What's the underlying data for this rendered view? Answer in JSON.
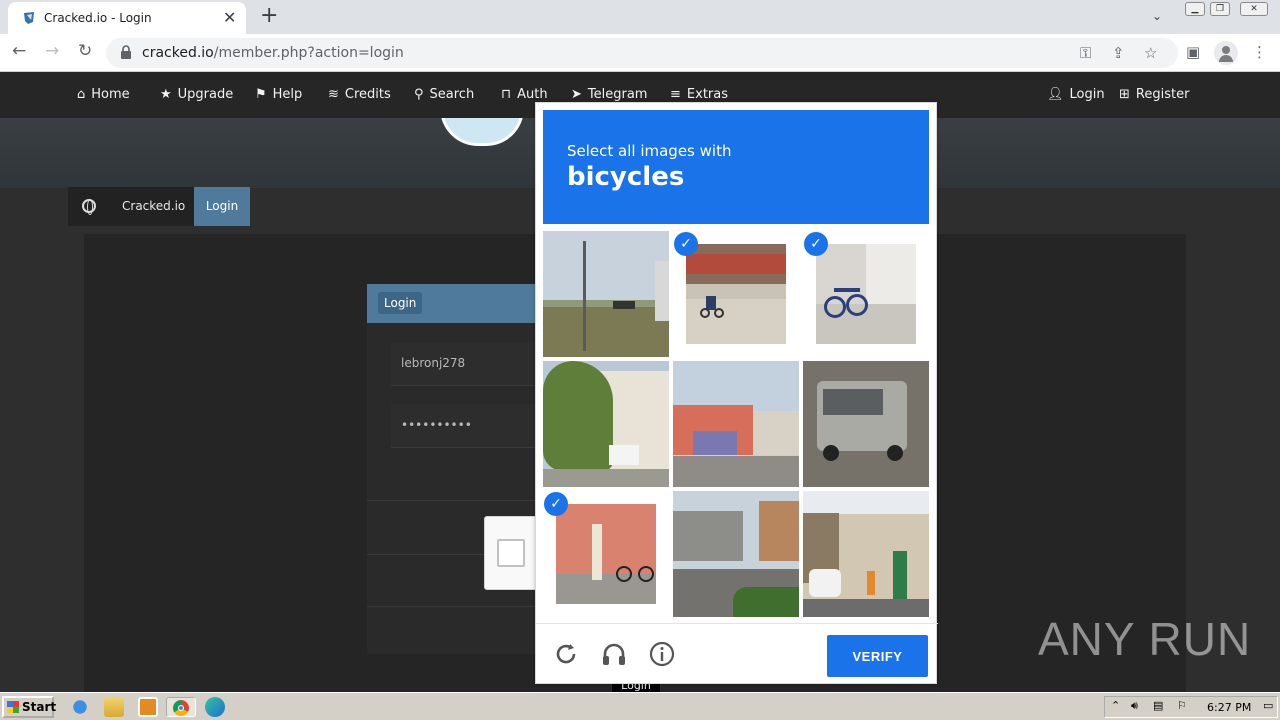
{
  "browser": {
    "tab_title": "Cracked.io - Login",
    "url_host": "cracked.io",
    "url_path": "/member.php?action=login"
  },
  "site_nav": {
    "items": [
      {
        "label": "Home",
        "icon": "home-icon"
      },
      {
        "label": "Upgrade",
        "icon": "star-icon"
      },
      {
        "label": "Help",
        "icon": "flag-icon"
      },
      {
        "label": "Credits",
        "icon": "coins-icon"
      },
      {
        "label": "Search",
        "icon": "search-icon"
      },
      {
        "label": "Auth",
        "icon": "lock-icon"
      },
      {
        "label": "Telegram",
        "icon": "telegram-icon"
      },
      {
        "label": "Extras",
        "icon": "menu-icon"
      }
    ],
    "right": [
      {
        "label": "Login",
        "icon": "user-icon"
      },
      {
        "label": "Register",
        "icon": "plus-square-icon"
      }
    ]
  },
  "breadcrumb": {
    "site": "Cracked.io",
    "current": "Login"
  },
  "login_panel": {
    "title": "Login",
    "username": "lebronj278",
    "password_mask": "••••••••••"
  },
  "tooltip": "Login",
  "captcha": {
    "prompt": "Select all images with",
    "object": "bicycles",
    "verify_label": "VERIFY",
    "tiles": [
      {
        "selected": false
      },
      {
        "selected": true
      },
      {
        "selected": true
      },
      {
        "selected": false
      },
      {
        "selected": false
      },
      {
        "selected": false
      },
      {
        "selected": true
      },
      {
        "selected": false
      },
      {
        "selected": false
      }
    ],
    "accent": "#1a73e8"
  },
  "watermark": "ANY RUN",
  "taskbar": {
    "start_label": "Start",
    "clock": "6:27 PM"
  }
}
